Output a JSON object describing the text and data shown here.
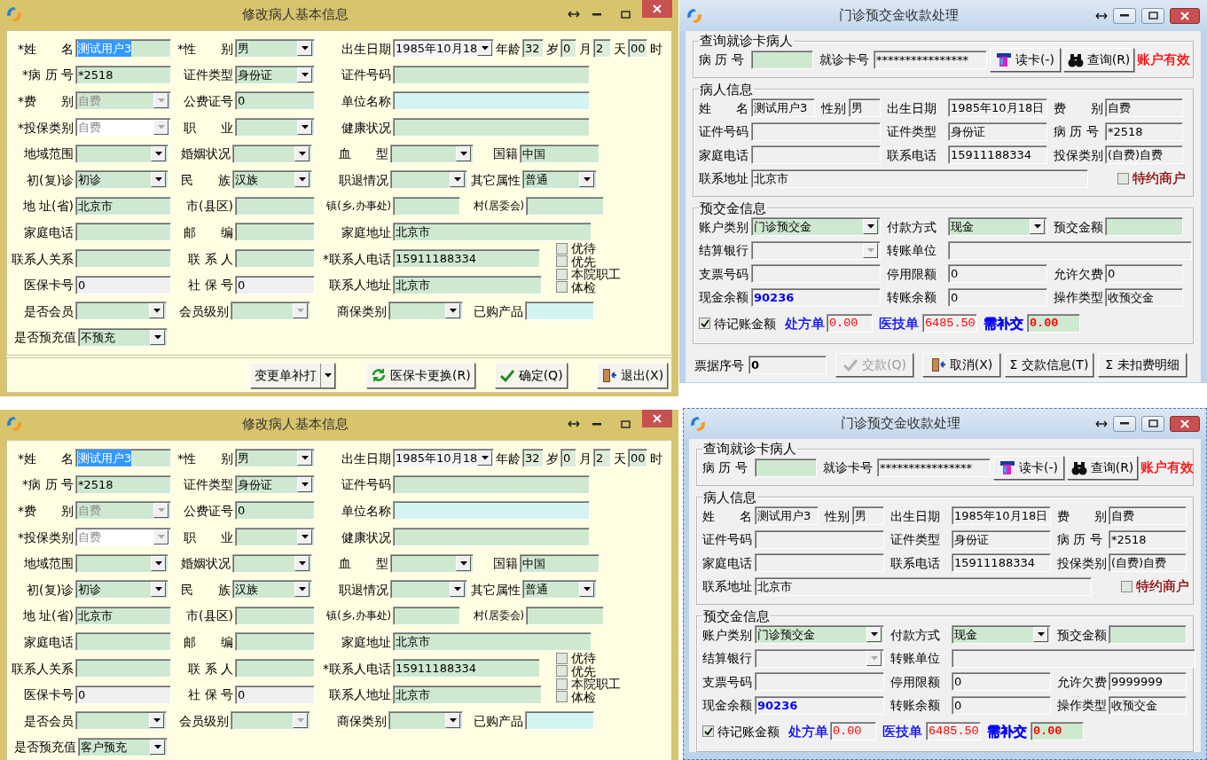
{
  "windows": [
    {
      "kind": "patient_form",
      "title": "修改病人基本信息",
      "rows": [
        [
          {
            "kind": "label",
            "text": "*姓　　名"
          },
          {
            "kind": "field",
            "value": "测试用户3",
            "color": "#cfe9d0",
            "selected": true
          },
          {
            "kind": "label",
            "text": "*性　　别"
          },
          {
            "kind": "combo",
            "value": "男",
            "color": "#cfe9d0"
          },
          {
            "kind": "label",
            "text": "出生日期"
          },
          {
            "kind": "combo",
            "value": "1985年10月18",
            "color": "#f4f4f4"
          },
          {
            "kind": "label",
            "text": "年龄"
          },
          {
            "kind": "field",
            "value": "32",
            "color": "#dcecd8"
          },
          {
            "kind": "label",
            "text": "岁"
          },
          {
            "kind": "field",
            "value": "0",
            "color": "#dcecd8"
          },
          {
            "kind": "label",
            "text": "月"
          },
          {
            "kind": "field",
            "value": "2",
            "color": "#dcecd8"
          },
          {
            "kind": "label",
            "text": "天"
          },
          {
            "kind": "field",
            "value": "00",
            "color": "#dcecd8"
          },
          {
            "kind": "label",
            "text": "时"
          }
        ],
        [
          {
            "kind": "label",
            "text": "*病 历 号"
          },
          {
            "kind": "field",
            "value": "*2518",
            "color": "#cfe9d0"
          },
          {
            "kind": "label",
            "text": "证件类型"
          },
          {
            "kind": "combo",
            "value": "身份证",
            "color": "#cfe9d0"
          },
          {
            "kind": "label",
            "text": "证件号码"
          },
          {
            "kind": "field",
            "color": "#cfe9d0"
          }
        ],
        [
          {
            "kind": "label",
            "text": "*费　　别"
          },
          {
            "kind": "combo",
            "value": "自费",
            "color": "#cfe9d0",
            "disabled": true
          },
          {
            "kind": "label",
            "text": "公费证号"
          },
          {
            "kind": "field",
            "value": "0",
            "color": "#cfe9d0"
          },
          {
            "kind": "label",
            "text": "单位名称"
          },
          {
            "kind": "field",
            "color": "#d4f4f4"
          }
        ],
        [
          {
            "kind": "label",
            "text": "*投保类别"
          },
          {
            "kind": "combo",
            "value": "自费",
            "color": "#ffffff",
            "disabled": true
          },
          {
            "kind": "label",
            "text": "职　　业"
          },
          {
            "kind": "combo",
            "color": "#cfe9d0"
          },
          {
            "kind": "label",
            "text": "健康状况"
          },
          {
            "kind": "field",
            "color": "#cfe9d0"
          }
        ],
        [
          {
            "kind": "label",
            "text": "地域范围"
          },
          {
            "kind": "combo",
            "color": "#cfe9d0"
          },
          {
            "kind": "label",
            "text": "婚姻状况"
          },
          {
            "kind": "combo",
            "color": "#cfe9d0"
          },
          {
            "kind": "label",
            "text": "血　　型"
          },
          {
            "kind": "combo",
            "color": "#cfe9d0"
          },
          {
            "kind": "label",
            "text": "国籍"
          },
          {
            "kind": "field",
            "value": "中国",
            "color": "#cfe9d0"
          }
        ],
        [
          {
            "kind": "label",
            "text": "初(复)诊"
          },
          {
            "kind": "combo",
            "value": "初诊",
            "color": "#cfe9d0"
          },
          {
            "kind": "label",
            "text": "民　　族"
          },
          {
            "kind": "combo",
            "value": "汉族",
            "color": "#cfe9d0"
          },
          {
            "kind": "label",
            "text": "职退情况"
          },
          {
            "kind": "combo",
            "color": "#cfe9d0"
          },
          {
            "kind": "label",
            "text": "其它属性"
          },
          {
            "kind": "combo",
            "value": "普通",
            "color": "#cfe9d0"
          }
        ],
        [
          {
            "kind": "label",
            "text": "地 址(省)"
          },
          {
            "kind": "field",
            "value": "北京市",
            "color": "#cfe9d0"
          },
          {
            "kind": "label",
            "text": "市(县区)"
          },
          {
            "kind": "field",
            "color": "#cfe9d0"
          },
          {
            "kind": "note_label",
            "text": "镇(乡,办事处)"
          },
          {
            "kind": "field",
            "color": "#cfe9d0"
          },
          {
            "kind": "note_label",
            "text": "村(居委会)"
          },
          {
            "kind": "field",
            "color": "#cfe9d0"
          }
        ],
        [
          {
            "kind": "label",
            "text": "家庭电话"
          },
          {
            "kind": "field",
            "color": "#cfe9d0"
          },
          {
            "kind": "label",
            "text": "邮　　编"
          },
          {
            "kind": "field",
            "color": "#cfe9d0"
          },
          {
            "kind": "label",
            "text": "家庭地址"
          },
          {
            "kind": "field",
            "value": "北京市",
            "color": "#cfe9d0"
          }
        ],
        [
          {
            "kind": "label",
            "text": "联系人关系"
          },
          {
            "kind": "field",
            "color": "#cfe9d0"
          },
          {
            "kind": "label",
            "text": "联 系 人"
          },
          {
            "kind": "field",
            "color": "#cfe9d0"
          },
          {
            "kind": "label",
            "text": "*联系人电话"
          },
          {
            "kind": "field",
            "value": "15911188334",
            "color": "#cfe9d0"
          }
        ],
        [
          {
            "kind": "label",
            "text": "医保卡号"
          },
          {
            "kind": "field",
            "value": "0",
            "color": "#f0f0f0"
          },
          {
            "kind": "label",
            "text": "社 保 号"
          },
          {
            "kind": "field",
            "value": "0",
            "color": "#f0f0f0"
          },
          {
            "kind": "label",
            "text": "联系人地址"
          },
          {
            "kind": "field",
            "value": "北京市",
            "color": "#cfe9d0"
          }
        ],
        [
          {
            "kind": "label",
            "text": "是否会员"
          },
          {
            "kind": "combo",
            "color": "#cfe9d0"
          },
          {
            "kind": "label",
            "text": "会员级别"
          },
          {
            "kind": "combo",
            "color": "#cfe9d0",
            "disabled": true
          },
          {
            "kind": "label",
            "text": "商保类别"
          },
          {
            "kind": "combo",
            "color": "#cfe9d0"
          },
          {
            "kind": "label",
            "text": "已购产品"
          },
          {
            "kind": "field",
            "color": "#d4f4f4"
          }
        ],
        [
          {
            "kind": "label",
            "text": "是否预充值"
          },
          {
            "kind": "combo",
            "value": "不预充",
            "color": "#cfe9d0"
          }
        ]
      ],
      "flags": [
        {
          "label": "优待",
          "checked": false
        },
        {
          "label": "优先",
          "checked": false
        },
        {
          "label": "本院职工",
          "checked": false
        },
        {
          "label": "体检",
          "checked": false
        }
      ],
      "footer": [
        {
          "kind": "split_button",
          "label": "变更单补打"
        },
        {
          "kind": "button",
          "label": "医保卡更换(R)"
        },
        {
          "kind": "button",
          "label": "确定(Q)"
        },
        {
          "kind": "button",
          "label": "退出(X)"
        }
      ]
    },
    {
      "kind": "deposit_form",
      "title": "门诊预交金收款处理",
      "groups": [
        {
          "title": "查询就诊卡病人",
          "rows": [
            [
              {
                "kind": "label",
                "text": "病 历 号"
              },
              {
                "kind": "field",
                "color": "#cfe9d0"
              },
              {
                "kind": "label",
                "text": "就诊卡号"
              },
              {
                "kind": "field",
                "value": "****************",
                "color": "#f0f0f0"
              },
              {
                "kind": "button",
                "label": "读卡(-)"
              },
              {
                "kind": "button",
                "label": "查询(R)"
              },
              {
                "kind": "status",
                "text": "账户有效",
                "color": "#ff0000"
              }
            ]
          ]
        },
        {
          "title": "病人信息",
          "rows": [
            [
              {
                "kind": "label",
                "text": "姓　　名"
              },
              {
                "kind": "group",
                "items": [
                  {
                    "kind": "field",
                    "value": "测试用户3",
                    "color": "#f0f0f0"
                  },
                  {
                    "kind": "label",
                    "text": "性别"
                  },
                  {
                    "kind": "field",
                    "value": "男",
                    "color": "#f0f0f0"
                  }
                ]
              },
              {
                "kind": "label",
                "text": "出生日期"
              },
              {
                "kind": "field",
                "value": "1985年10月18日",
                "color": "#f0f0f0"
              },
              {
                "kind": "label",
                "text": "费　　别"
              },
              {
                "kind": "field",
                "value": "自费",
                "color": "#f0f0f0"
              }
            ],
            [
              {
                "kind": "label",
                "text": "证件号码"
              },
              {
                "kind": "field",
                "color": "#f0f0f0"
              },
              {
                "kind": "label",
                "text": "证件类型"
              },
              {
                "kind": "field",
                "value": "身份证",
                "color": "#f0f0f0"
              },
              {
                "kind": "label",
                "text": "病 历 号"
              },
              {
                "kind": "field",
                "value": "*2518",
                "color": "#f0f0f0"
              }
            ],
            [
              {
                "kind": "label",
                "text": "家庭电话"
              },
              {
                "kind": "field",
                "color": "#f0f0f0"
              },
              {
                "kind": "label",
                "text": "联系电话"
              },
              {
                "kind": "field",
                "value": "15911188334",
                "color": "#f0f0f0"
              },
              {
                "kind": "label",
                "text": "投保类别"
              },
              {
                "kind": "field",
                "value": "(自费)自费",
                "color": "#f0f0f0"
              }
            ],
            [
              {
                "kind": "label",
                "text": "联系地址"
              },
              {
                "kind": "field",
                "value": "北京市",
                "color": "#f0f0f0"
              },
              {
                "kind": "check",
                "label": "特约商户",
                "checked": false,
                "color": "#8b0000"
              }
            ]
          ]
        },
        {
          "title": "预交金信息",
          "rows": [
            [
              {
                "kind": "label",
                "text": "账户类别"
              },
              {
                "kind": "combo",
                "value": "门诊预交金",
                "color": "#cfe9d0"
              },
              {
                "kind": "label",
                "text": "付款方式"
              },
              {
                "kind": "combo",
                "value": "现金",
                "color": "#cfe9d0"
              },
              {
                "kind": "label",
                "text": "预交金额"
              },
              {
                "kind": "field",
                "color": "#cfe9d0"
              }
            ],
            [
              {
                "kind": "label",
                "text": "结算银行"
              },
              {
                "kind": "combo",
                "color": "#f0f0f0",
                "disabled": true
              },
              {
                "kind": "label",
                "text": "转账单位"
              },
              {
                "kind": "field",
                "color": "#f0f0f0"
              }
            ],
            [
              {
                "kind": "label",
                "text": "支票号码"
              },
              {
                "kind": "field",
                "color": "#f0f0f0"
              },
              {
                "kind": "label",
                "text": "停用限额"
              },
              {
                "kind": "field",
                "value": "0",
                "color": "#f0f0f0"
              },
              {
                "kind": "label",
                "text": "允许欠费"
              },
              {
                "kind": "field",
                "value": "0",
                "color": "#f0f0f0"
              }
            ],
            [
              {
                "kind": "label",
                "text": "现金余额"
              },
              {
                "kind": "balance_field",
                "value": "90236",
                "color": "#f0f0f0"
              },
              {
                "kind": "label",
                "text": "转账余额"
              },
              {
                "kind": "field",
                "value": "0",
                "color": "#f0f0f0"
              },
              {
                "kind": "label",
                "text": "操作类型"
              },
              {
                "kind": "field",
                "value": "收预交金",
                "color": "#f0f0f0"
              }
            ]
          ],
          "summary": [
            {
              "kind": "check",
              "label": "待记账金额",
              "checked": true
            },
            {
              "kind": "label",
              "text": "处方单",
              "color": "#0000ff"
            },
            {
              "kind": "amount_field",
              "value": "0.00",
              "color": "#f0f0f0"
            },
            {
              "kind": "label",
              "text": "医技单",
              "color": "#0000ff"
            },
            {
              "kind": "amount_field",
              "value": "6485.50",
              "color": "#f0f0f0"
            },
            {
              "kind": "label",
              "text": "需补交",
              "color": "#0000ff",
              "emphasized": true
            },
            {
              "kind": "amount_field",
              "value": "0.00",
              "color": "#cfe9d0",
              "emphasized": true
            }
          ]
        }
      ],
      "footer": [
        {
          "kind": "label",
          "text": "票据序号"
        },
        {
          "kind": "field",
          "value": "0",
          "color": "#f0f0f0",
          "emphasized": true
        },
        {
          "kind": "button",
          "label": "交款(Q)",
          "disabled": true
        },
        {
          "kind": "button",
          "label": "取消(X)"
        },
        {
          "kind": "button",
          "label": "Σ 交款信息(T)"
        },
        {
          "kind": "button",
          "label": "Σ 未扣费明细"
        }
      ]
    },
    {
      "kind": "patient_form",
      "title": "修改病人基本信息",
      "rows": [
        [
          {
            "kind": "label",
            "text": "*姓　　名"
          },
          {
            "kind": "field",
            "value": "测试用户3",
            "color": "#cfe9d0",
            "selected": true
          },
          {
            "kind": "label",
            "text": "*性　　别"
          },
          {
            "kind": "combo",
            "value": "男",
            "color": "#cfe9d0"
          },
          {
            "kind": "label",
            "text": "出生日期"
          },
          {
            "kind": "combo",
            "value": "1985年10月18",
            "color": "#f4f4f4"
          },
          {
            "kind": "label",
            "text": "年龄"
          },
          {
            "kind": "field",
            "value": "32",
            "color": "#dcecd8"
          },
          {
            "kind": "label",
            "text": "岁"
          },
          {
            "kind": "field",
            "value": "0",
            "color": "#dcecd8"
          },
          {
            "kind": "label",
            "text": "月"
          },
          {
            "kind": "field",
            "value": "2",
            "color": "#dcecd8"
          },
          {
            "kind": "label",
            "text": "天"
          },
          {
            "kind": "field",
            "value": "00",
            "color": "#dcecd8"
          },
          {
            "kind": "label",
            "text": "时"
          }
        ],
        [
          {
            "kind": "label",
            "text": "*病 历 号"
          },
          {
            "kind": "field",
            "value": "*2518",
            "color": "#cfe9d0"
          },
          {
            "kind": "label",
            "text": "证件类型"
          },
          {
            "kind": "combo",
            "value": "身份证",
            "color": "#cfe9d0"
          },
          {
            "kind": "label",
            "text": "证件号码"
          },
          {
            "kind": "field",
            "color": "#cfe9d0"
          }
        ],
        [
          {
            "kind": "label",
            "text": "*费　　别"
          },
          {
            "kind": "combo",
            "value": "自费",
            "color": "#cfe9d0",
            "disabled": true
          },
          {
            "kind": "label",
            "text": "公费证号"
          },
          {
            "kind": "field",
            "value": "0",
            "color": "#cfe9d0"
          },
          {
            "kind": "label",
            "text": "单位名称"
          },
          {
            "kind": "field",
            "color": "#d4f4f4"
          }
        ],
        [
          {
            "kind": "label",
            "text": "*投保类别"
          },
          {
            "kind": "combo",
            "value": "自费",
            "color": "#ffffff",
            "disabled": true
          },
          {
            "kind": "label",
            "text": "职　　业"
          },
          {
            "kind": "combo",
            "color": "#cfe9d0"
          },
          {
            "kind": "label",
            "text": "健康状况"
          },
          {
            "kind": "field",
            "color": "#cfe9d0"
          }
        ],
        [
          {
            "kind": "label",
            "text": "地域范围"
          },
          {
            "kind": "combo",
            "color": "#cfe9d0"
          },
          {
            "kind": "label",
            "text": "婚姻状况"
          },
          {
            "kind": "combo",
            "color": "#cfe9d0"
          },
          {
            "kind": "label",
            "text": "血　　型"
          },
          {
            "kind": "combo",
            "color": "#cfe9d0"
          },
          {
            "kind": "label",
            "text": "国籍"
          },
          {
            "kind": "field",
            "value": "中国",
            "color": "#cfe9d0"
          }
        ],
        [
          {
            "kind": "label",
            "text": "初(复)诊"
          },
          {
            "kind": "combo",
            "value": "初诊",
            "color": "#cfe9d0"
          },
          {
            "kind": "label",
            "text": "民　　族"
          },
          {
            "kind": "combo",
            "value": "汉族",
            "color": "#cfe9d0"
          },
          {
            "kind": "label",
            "text": "职退情况"
          },
          {
            "kind": "combo",
            "color": "#cfe9d0"
          },
          {
            "kind": "label",
            "text": "其它属性"
          },
          {
            "kind": "combo",
            "value": "普通",
            "color": "#cfe9d0"
          }
        ],
        [
          {
            "kind": "label",
            "text": "地 址(省)"
          },
          {
            "kind": "field",
            "value": "北京市",
            "color": "#cfe9d0"
          },
          {
            "kind": "label",
            "text": "市(县区)"
          },
          {
            "kind": "field",
            "color": "#cfe9d0"
          },
          {
            "kind": "note_label",
            "text": "镇(乡,办事处)"
          },
          {
            "kind": "field",
            "color": "#cfe9d0"
          },
          {
            "kind": "note_label",
            "text": "村(居委会)"
          },
          {
            "kind": "field",
            "color": "#cfe9d0"
          }
        ],
        [
          {
            "kind": "label",
            "text": "家庭电话"
          },
          {
            "kind": "field",
            "color": "#cfe9d0"
          },
          {
            "kind": "label",
            "text": "邮　　编"
          },
          {
            "kind": "field",
            "color": "#cfe9d0"
          },
          {
            "kind": "label",
            "text": "家庭地址"
          },
          {
            "kind": "field",
            "value": "北京市",
            "color": "#cfe9d0"
          }
        ],
        [
          {
            "kind": "label",
            "text": "联系人关系"
          },
          {
            "kind": "field",
            "color": "#cfe9d0"
          },
          {
            "kind": "label",
            "text": "联 系 人"
          },
          {
            "kind": "field",
            "color": "#cfe9d0"
          },
          {
            "kind": "label",
            "text": "*联系人电话"
          },
          {
            "kind": "field",
            "value": "15911188334",
            "color": "#cfe9d0"
          }
        ],
        [
          {
            "kind": "label",
            "text": "医保卡号"
          },
          {
            "kind": "field",
            "value": "0",
            "color": "#f0f0f0"
          },
          {
            "kind": "label",
            "text": "社 保 号"
          },
          {
            "kind": "field",
            "value": "0",
            "color": "#f0f0f0"
          },
          {
            "kind": "label",
            "text": "联系人地址"
          },
          {
            "kind": "field",
            "value": "北京市",
            "color": "#cfe9d0"
          }
        ],
        [
          {
            "kind": "label",
            "text": "是否会员"
          },
          {
            "kind": "combo",
            "color": "#cfe9d0"
          },
          {
            "kind": "label",
            "text": "会员级别"
          },
          {
            "kind": "combo",
            "color": "#cfe9d0",
            "disabled": true
          },
          {
            "kind": "label",
            "text": "商保类别"
          },
          {
            "kind": "combo",
            "color": "#cfe9d0"
          },
          {
            "kind": "label",
            "text": "已购产品"
          },
          {
            "kind": "field",
            "color": "#d4f4f4"
          }
        ],
        [
          {
            "kind": "label",
            "text": "是否预充值"
          },
          {
            "kind": "combo",
            "value": "客户预充",
            "color": "#cfe9d0"
          }
        ]
      ],
      "flags": [
        {
          "label": "优待",
          "checked": false
        },
        {
          "label": "优先",
          "checked": false
        },
        {
          "label": "本院职工",
          "checked": false
        },
        {
          "label": "体检",
          "checked": false
        }
      ]
    },
    {
      "kind": "deposit_form",
      "title": "门诊预交金收款处理",
      "groups": [
        {
          "title": "查询就诊卡病人",
          "rows": [
            [
              {
                "kind": "label",
                "text": "病 历 号"
              },
              {
                "kind": "field",
                "color": "#cfe9d0"
              },
              {
                "kind": "label",
                "text": "就诊卡号"
              },
              {
                "kind": "field",
                "value": "****************",
                "color": "#f0f0f0"
              },
              {
                "kind": "button",
                "label": "读卡(-)"
              },
              {
                "kind": "button",
                "label": "查询(R)"
              },
              {
                "kind": "status",
                "text": "账户有效",
                "color": "#ff0000"
              }
            ]
          ]
        },
        {
          "title": "病人信息",
          "rows": [
            [
              {
                "kind": "label",
                "text": "姓　　名"
              },
              {
                "kind": "group",
                "items": [
                  {
                    "kind": "field",
                    "value": "测试用户3",
                    "color": "#f0f0f0"
                  },
                  {
                    "kind": "label",
                    "text": "性别"
                  },
                  {
                    "kind": "field",
                    "value": "男",
                    "color": "#f0f0f0"
                  }
                ]
              },
              {
                "kind": "label",
                "text": "出生日期"
              },
              {
                "kind": "field",
                "value": "1985年10月18日",
                "color": "#f0f0f0"
              },
              {
                "kind": "label",
                "text": "费　　别"
              },
              {
                "kind": "field",
                "value": "自费",
                "color": "#f0f0f0"
              }
            ],
            [
              {
                "kind": "label",
                "text": "证件号码"
              },
              {
                "kind": "field",
                "color": "#f0f0f0"
              },
              {
                "kind": "label",
                "text": "证件类型"
              },
              {
                "kind": "field",
                "value": "身份证",
                "color": "#f0f0f0"
              },
              {
                "kind": "label",
                "text": "病 历 号"
              },
              {
                "kind": "field",
                "value": "*2518",
                "color": "#f0f0f0"
              }
            ],
            [
              {
                "kind": "label",
                "text": "家庭电话"
              },
              {
                "kind": "field",
                "color": "#f0f0f0"
              },
              {
                "kind": "label",
                "text": "联系电话"
              },
              {
                "kind": "field",
                "value": "15911188334",
                "color": "#f0f0f0"
              },
              {
                "kind": "label",
                "text": "投保类别"
              },
              {
                "kind": "field",
                "value": "(自费)自费",
                "color": "#f0f0f0"
              }
            ],
            [
              {
                "kind": "label",
                "text": "联系地址"
              },
              {
                "kind": "field",
                "value": "北京市",
                "color": "#f0f0f0"
              },
              {
                "kind": "check",
                "label": "特约商户",
                "checked": false,
                "color": "#8b0000"
              }
            ]
          ]
        },
        {
          "title": "预交金信息",
          "rows": [
            [
              {
                "kind": "label",
                "text": "账户类别"
              },
              {
                "kind": "combo",
                "value": "门诊预交金",
                "color": "#cfe9d0"
              },
              {
                "kind": "label",
                "text": "付款方式"
              },
              {
                "kind": "combo",
                "value": "现金",
                "color": "#cfe9d0"
              },
              {
                "kind": "label",
                "text": "预交金额"
              },
              {
                "kind": "field",
                "color": "#cfe9d0"
              }
            ],
            [
              {
                "kind": "label",
                "text": "结算银行"
              },
              {
                "kind": "combo",
                "color": "#f0f0f0",
                "disabled": true
              },
              {
                "kind": "label",
                "text": "转账单位"
              },
              {
                "kind": "field",
                "color": "#f0f0f0"
              }
            ],
            [
              {
                "kind": "label",
                "text": "支票号码"
              },
              {
                "kind": "field",
                "color": "#f0f0f0"
              },
              {
                "kind": "label",
                "text": "停用限额"
              },
              {
                "kind": "field",
                "value": "0",
                "color": "#f0f0f0"
              },
              {
                "kind": "label",
                "text": "允许欠费"
              },
              {
                "kind": "field",
                "value": "9999999",
                "color": "#f0f0f0"
              }
            ],
            [
              {
                "kind": "label",
                "text": "现金余额"
              },
              {
                "kind": "balance_field",
                "value": "90236",
                "color": "#f0f0f0"
              },
              {
                "kind": "label",
                "text": "转账余额"
              },
              {
                "kind": "field",
                "value": "0",
                "color": "#f0f0f0"
              },
              {
                "kind": "label",
                "text": "操作类型"
              },
              {
                "kind": "field",
                "value": "收预交金",
                "color": "#f0f0f0"
              }
            ]
          ],
          "summary": [
            {
              "kind": "check",
              "label": "待记账金额",
              "checked": true
            },
            {
              "kind": "label",
              "text": "处方单",
              "color": "#0000ff"
            },
            {
              "kind": "amount_field",
              "value": "0.00",
              "color": "#f0f0f0"
            },
            {
              "kind": "label",
              "text": "医技单",
              "color": "#0000ff"
            },
            {
              "kind": "amount_field",
              "value": "6485.50",
              "color": "#f0f0f0"
            },
            {
              "kind": "label",
              "text": "需补交",
              "color": "#0000ff",
              "emphasized": true
            },
            {
              "kind": "amount_field",
              "value": "0.00",
              "color": "#cfe9d0",
              "emphasized": true
            }
          ]
        }
      ]
    }
  ]
}
